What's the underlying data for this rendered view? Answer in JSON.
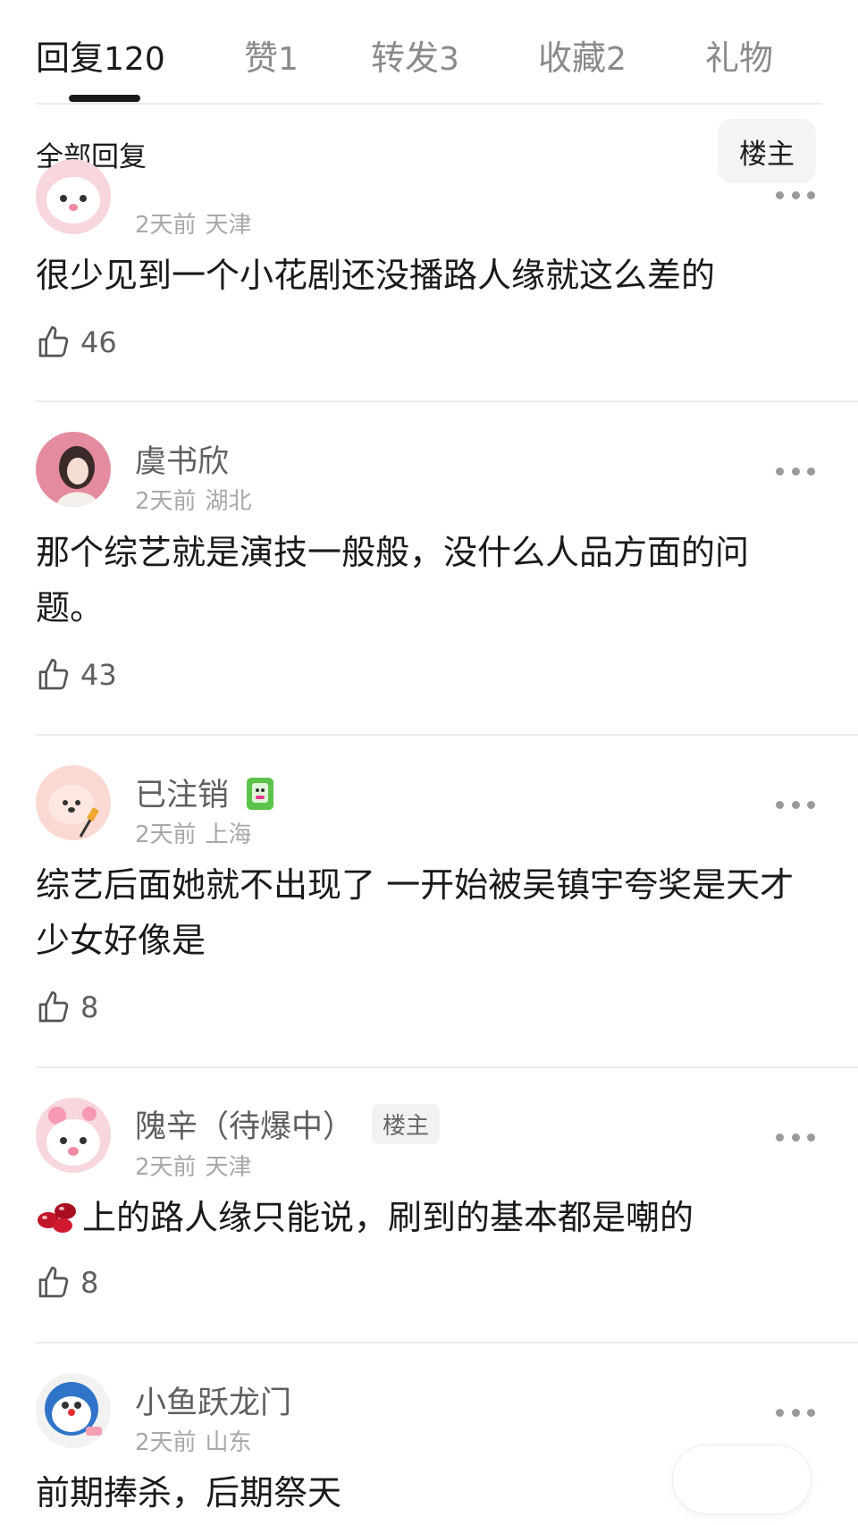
{
  "tabs": [
    {
      "label": "回复",
      "count": "120"
    },
    {
      "label": "赞",
      "count": "1"
    },
    {
      "label": "转发",
      "count": "3"
    },
    {
      "label": "收藏",
      "count": "2"
    },
    {
      "label": "礼物",
      "count": ""
    }
  ],
  "subheader": {
    "title": "全部回复",
    "filter": "楼主"
  },
  "comments": [
    {
      "user": "",
      "time": "2天前",
      "location": "天津",
      "text": "很少见到一个小花剧还没播路人缘就这么差的",
      "likes": "46"
    },
    {
      "user": "虞书欣",
      "time": "2天前",
      "location": "湖北",
      "text": "那个综艺就是演技一般般，没什么人品方面的问题。",
      "likes": "43"
    },
    {
      "user": "已注销",
      "time": "2天前",
      "location": "上海",
      "text": "综艺后面她就不出现了 一开始被吴镇宇夸奖是天才少女好像是",
      "likes": "8"
    },
    {
      "user": "隗辛（待爆中）",
      "badge": "楼主",
      "time": "2天前",
      "location": "天津",
      "text": "上的路人缘只能说，刷到的基本都是嘲的",
      "likes": "8"
    },
    {
      "user": "小鱼跃龙门",
      "time": "2天前",
      "location": "山东",
      "text": "前期捧杀，后期祭天",
      "likes": ""
    }
  ]
}
